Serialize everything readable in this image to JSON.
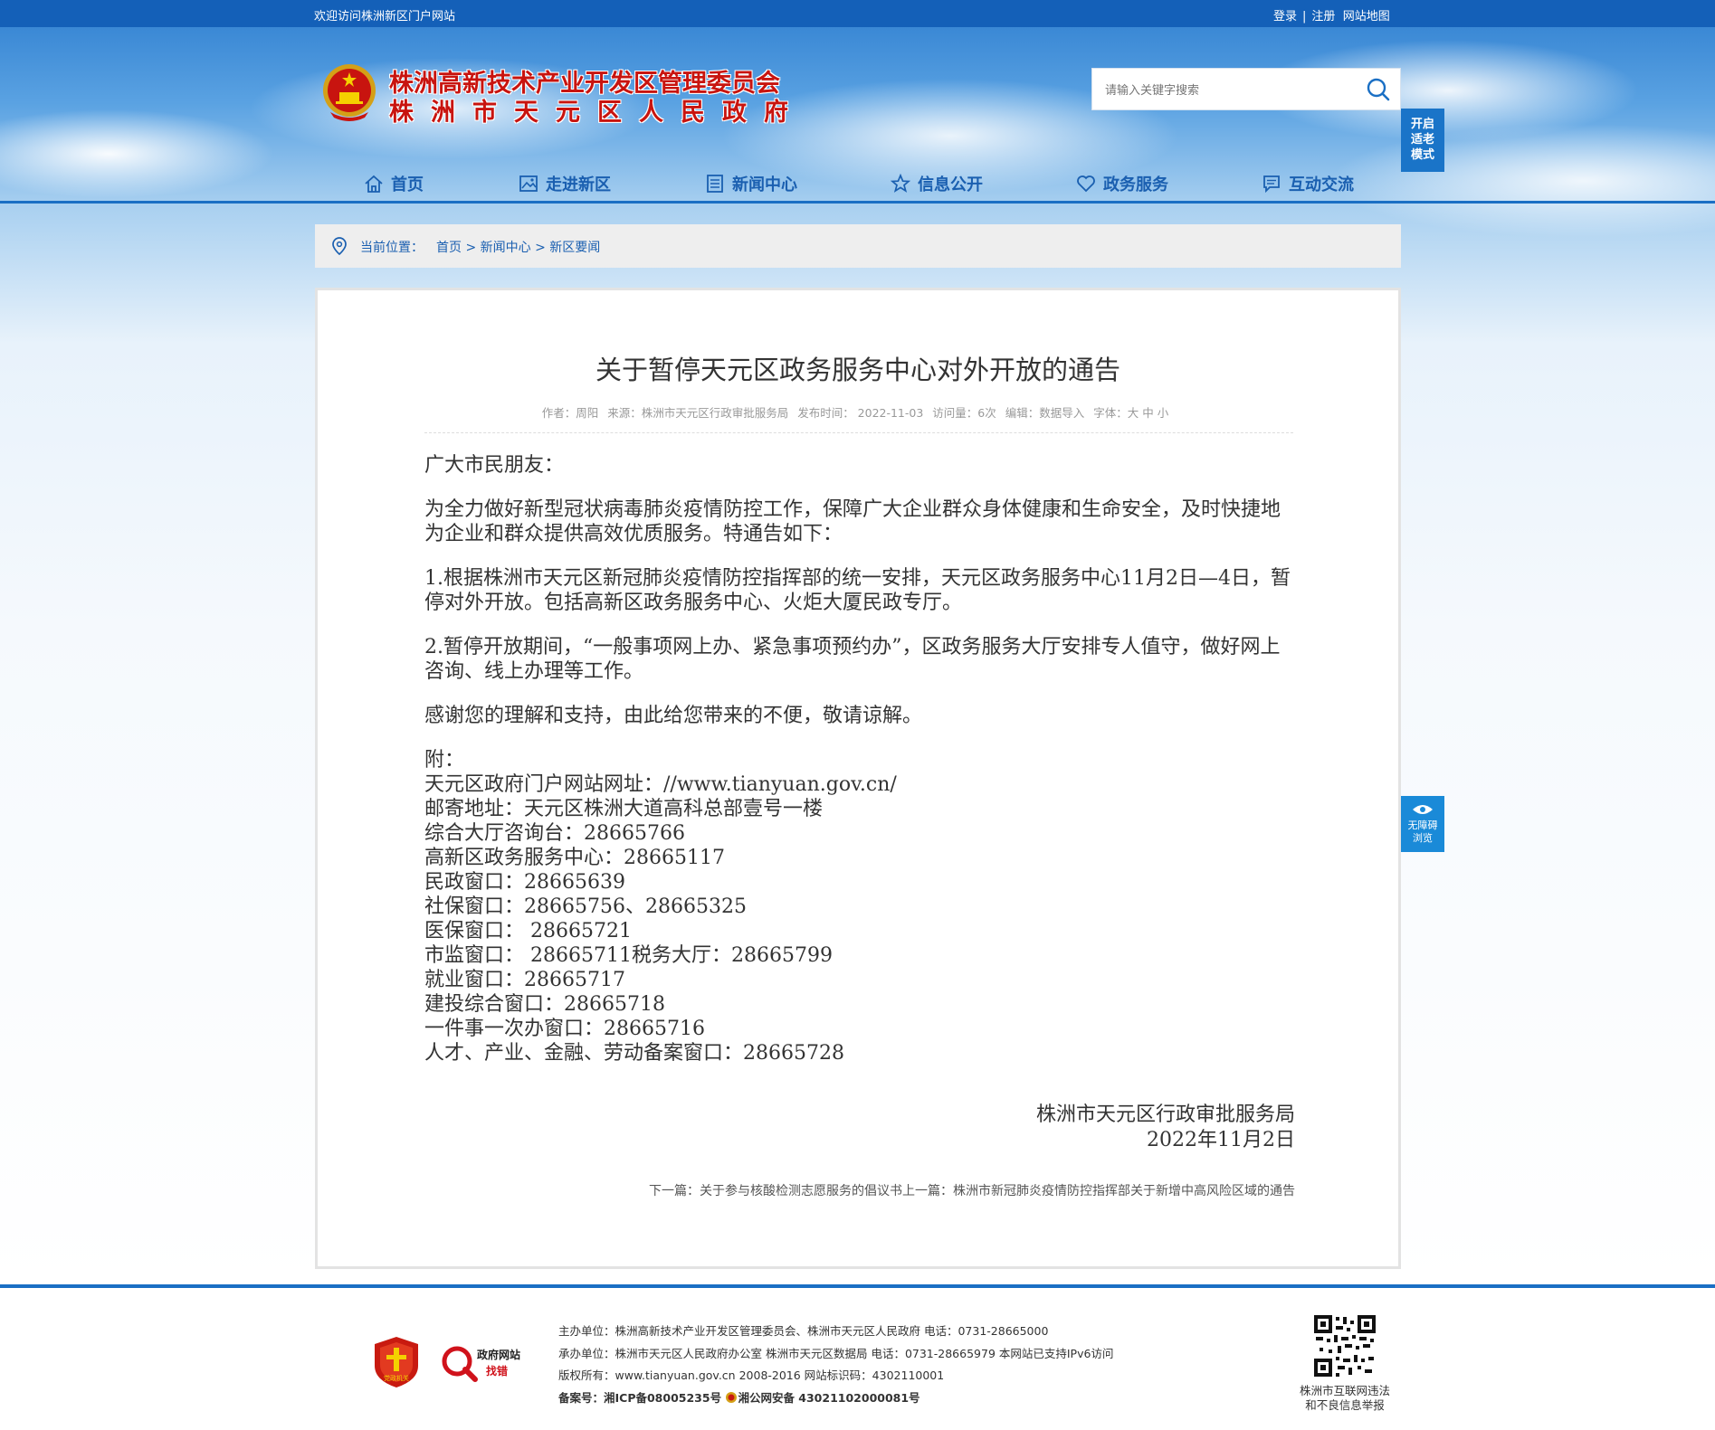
{
  "topbar": {
    "welcome": "欢迎访问株洲新区门户网站",
    "login": "登录",
    "sep": "|",
    "register": "注册",
    "sitemap": "网站地图"
  },
  "header": {
    "title_line1": "株洲高新技术产业开发区管理委员会",
    "title_line2": "株洲市天元区人民政府",
    "search_placeholder": "请输入关键字搜索",
    "elder_mode": [
      "开启",
      "适老",
      "模式"
    ]
  },
  "nav": {
    "items": [
      {
        "label": "首页",
        "icon": "home-icon"
      },
      {
        "label": "走进新区",
        "icon": "picture-icon"
      },
      {
        "label": "新闻中心",
        "icon": "newspaper-icon"
      },
      {
        "label": "信息公开",
        "icon": "star-icon"
      },
      {
        "label": "政务服务",
        "icon": "heart-icon"
      },
      {
        "label": "互动交流",
        "icon": "chat-icon"
      }
    ]
  },
  "breadcrumb": {
    "label": "当前位置：",
    "home": "首页",
    "sep": " > ",
    "news": "新闻中心",
    "current": "新区要闻"
  },
  "article": {
    "title": "关于暂停天元区政务服务中心对外开放的通告",
    "meta": {
      "author": "作者：周阳",
      "source": "来源：株洲市天元区行政审批服务局",
      "date": "发布时间：  2022-11-03",
      "views": "访问量：6次",
      "editor": "编辑：数据导入",
      "font_label": "字体：",
      "font_large": "大",
      "font_medium": "中",
      "font_small": "小"
    },
    "greeting": "广大市民朋友：",
    "paragraphs": [
      "为全力做好新型冠状病毒肺炎疫情防控工作，保障广大企业群众身体健康和生命安全，及时快捷地为企业和群众提供高效优质服务。特通告如下：",
      "1.根据株洲市天元区新冠肺炎疫情防控指挥部的统一安排，天元区政务服务中心11月2日—4日，暂停对外开放。包括高新区政务服务中心、火炬大厦民政专厅。",
      "2.暂停开放期间，“一般事项网上办、紧急事项预约办”，区政务服务大厅安排专人值守，做好网上咨询、线上办理等工作。",
      "感谢您的理解和支持，由此给您带来的不便，敬请谅解。"
    ],
    "attachment": [
      "附：",
      "天元区政府门户网站网址：//www.tianyuan.gov.cn/",
      "邮寄地址：天元区株洲大道高科总部壹号一楼",
      "综合大厅咨询台：28665766",
      "高新区政务服务中心：28665117",
      "民政窗口：28665639",
      "社保窗口：28665756、28665325",
      "医保窗口： 28665721",
      "市监窗口： 28665711税务大厅：28665799",
      "就业窗口：28665717",
      "建投综合窗口：28665718",
      "一件事一次办窗口：28665716",
      "人才、产业、金融、劳动备案窗口：28665728"
    ],
    "signature": "株洲市天元区行政审批服务局",
    "sign_date": "2022年11月2日",
    "next_label": "下一篇：",
    "next_title": "关于参与核酸检测志愿服务的倡议书",
    "prev_label": "上一篇：",
    "prev_title": "株洲市新冠肺炎疫情防控指挥部关于新增中高风险区域的通告"
  },
  "a11y": {
    "label1": "无障碍",
    "label2": "浏览"
  },
  "footer": {
    "host": "主办单位：株洲高新技术产业开发区管理委员会、株洲市天元区人民政府 电话：0731-28665000",
    "organizer": "承办单位：株洲市天元区人民政府办公室 株洲市天元区数据局 电话：0731-28665979 本网站已支持IPv6访问",
    "copyright": "版权所有：www.tianyuan.gov.cn 2008-2016 网站标识码：4302110001",
    "icp": "备案号：湘ICP备08005235号",
    "police": "湘公网安备 43021102000081号",
    "badge1_text": "党政机关",
    "badge2_line1": "政府网站",
    "badge2_line2": "找错",
    "qr_text_line1": "株洲市互联网违法",
    "qr_text_line2": "和不良信息举报"
  },
  "colors": {
    "topbar": "#1460b8",
    "nav_text": "#1a5fb0",
    "title_red": "#c8140f",
    "accent": "#1a6fc4"
  }
}
